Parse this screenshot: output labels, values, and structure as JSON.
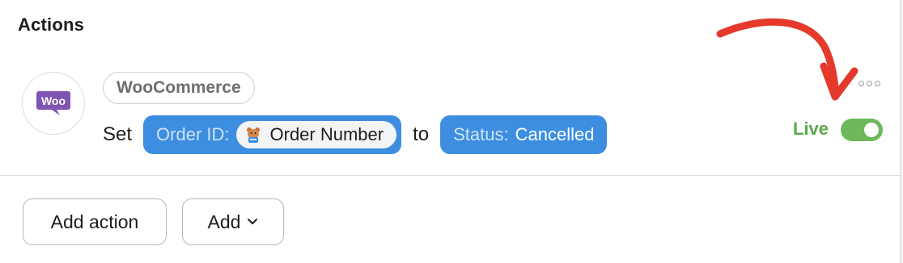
{
  "section": {
    "title": "Actions"
  },
  "action": {
    "app_name": "WooCommerce",
    "logo_text": "Woo",
    "verb": "Set",
    "field": {
      "key": "Order ID:",
      "token_value": "Order Number",
      "token_icon": "wpforms-bear-icon"
    },
    "connector": "to",
    "status": {
      "key": "Status:",
      "value": "Cancelled"
    },
    "more_icon": "more-horizontal-icon",
    "live_label": "Live",
    "live_enabled": true
  },
  "footer": {
    "add_action_label": "Add action",
    "add_label": "Add"
  },
  "colors": {
    "pill_blue": "#3d8ee0",
    "live_green": "#5aa84c",
    "toggle_green": "#6cb85a",
    "annotation_red": "#e4392b",
    "woo_purple": "#7f54b3"
  }
}
